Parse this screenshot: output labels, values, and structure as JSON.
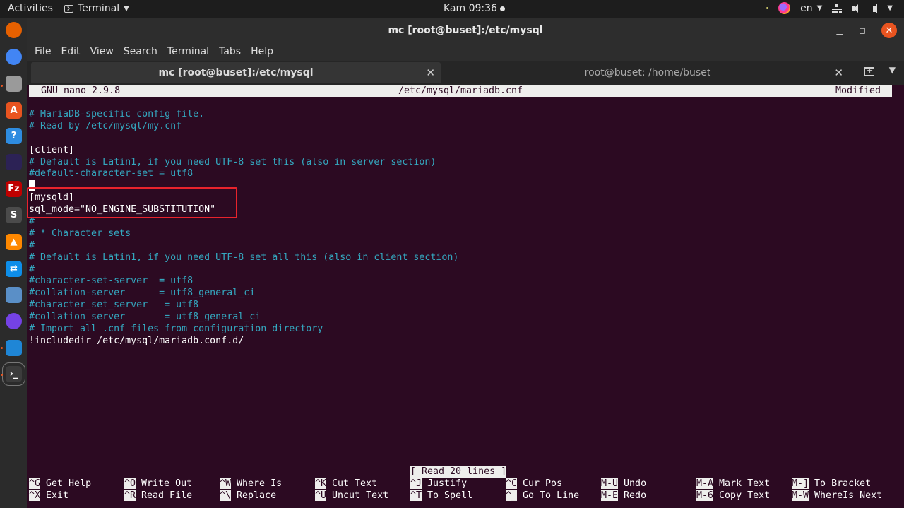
{
  "topbar": {
    "activities": "Activities",
    "app_name": "Terminal",
    "clock": "Kam 09:36",
    "lang": "en"
  },
  "window": {
    "title": "mc [root@buset]:/etc/mysql",
    "menu": [
      "File",
      "Edit",
      "View",
      "Search",
      "Terminal",
      "Tabs",
      "Help"
    ],
    "tabs": [
      {
        "label": "mc [root@buset]:/etc/mysql",
        "active": true
      },
      {
        "label": "root@buset: /home/buset",
        "active": false
      }
    ]
  },
  "nano": {
    "version": "GNU nano 2.9.8",
    "file": "/etc/mysql/mariadb.cnf",
    "status": "Modified",
    "lines": [
      {
        "text": "# MariaDB-specific config file.",
        "kind": "comment"
      },
      {
        "text": "# Read by /etc/mysql/my.cnf",
        "kind": "comment"
      },
      {
        "text": "",
        "kind": "plain"
      },
      {
        "text": "[client]",
        "kind": "plain"
      },
      {
        "text": "# Default is Latin1, if you need UTF-8 set this (also in server section)",
        "kind": "comment"
      },
      {
        "text": "#default-character-set = utf8",
        "kind": "comment"
      },
      {
        "text": "",
        "kind": "cursor"
      },
      {
        "text": "[mysqld]",
        "kind": "plain"
      },
      {
        "text": "sql_mode=\"NO_ENGINE_SUBSTITUTION\"",
        "kind": "plain"
      },
      {
        "text": "#",
        "kind": "comment"
      },
      {
        "text": "# * Character sets",
        "kind": "comment"
      },
      {
        "text": "#",
        "kind": "comment"
      },
      {
        "text": "# Default is Latin1, if you need UTF-8 set all this (also in client section)",
        "kind": "comment"
      },
      {
        "text": "#",
        "kind": "comment"
      },
      {
        "text": "#character-set-server  = utf8",
        "kind": "comment"
      },
      {
        "text": "#collation-server      = utf8_general_ci",
        "kind": "comment"
      },
      {
        "text": "#character_set_server   = utf8",
        "kind": "comment"
      },
      {
        "text": "#collation_server       = utf8_general_ci",
        "kind": "comment"
      },
      {
        "text": "# Import all .cnf files from configuration directory",
        "kind": "comment"
      },
      {
        "text": "!includedir /etc/mysql/mariadb.conf.d/",
        "kind": "plain"
      }
    ],
    "message": "[ Read 20 lines ]",
    "shortcuts_row1": [
      {
        "key": "^G",
        "label": "Get Help"
      },
      {
        "key": "^O",
        "label": "Write Out"
      },
      {
        "key": "^W",
        "label": "Where Is"
      },
      {
        "key": "^K",
        "label": "Cut Text"
      },
      {
        "key": "^J",
        "label": "Justify"
      },
      {
        "key": "^C",
        "label": "Cur Pos"
      },
      {
        "key": "M-U",
        "label": "Undo"
      },
      {
        "key": "M-A",
        "label": "Mark Text"
      },
      {
        "key": "M-]",
        "label": "To Bracket"
      }
    ],
    "shortcuts_row2": [
      {
        "key": "^X",
        "label": "Exit"
      },
      {
        "key": "^R",
        "label": "Read File"
      },
      {
        "key": "^\\",
        "label": "Replace"
      },
      {
        "key": "^U",
        "label": "Uncut Text"
      },
      {
        "key": "^T",
        "label": "To Spell"
      },
      {
        "key": "^_",
        "label": "Go To Line"
      },
      {
        "key": "M-E",
        "label": "Redo"
      },
      {
        "key": "M-6",
        "label": "Copy Text"
      },
      {
        "key": "M-W",
        "label": "WhereIs Next"
      }
    ]
  },
  "dock": [
    {
      "icon": "firefox-icon",
      "color": "#e66000"
    },
    {
      "icon": "chrome-icon",
      "color": "#4285f4"
    },
    {
      "icon": "files-icon",
      "color": "#9a9a9a"
    },
    {
      "icon": "software-center-icon",
      "color": "#e95420"
    },
    {
      "icon": "help-icon",
      "color": "#2e8ce0"
    },
    {
      "icon": "eclipse-icon",
      "color": "#2c2255"
    },
    {
      "icon": "filezilla-icon",
      "color": "#bf0000"
    },
    {
      "icon": "sublime-text-icon",
      "color": "#4b4b4b"
    },
    {
      "icon": "vlc-icon",
      "color": "#ff8800"
    },
    {
      "icon": "teamviewer-icon",
      "color": "#0e8ee9"
    },
    {
      "icon": "dbeaver-icon",
      "color": "#5a8fc7"
    },
    {
      "icon": "firefox-dev-icon",
      "color": "#7542e5"
    },
    {
      "icon": "vscode-icon",
      "color": "#1f86d6"
    },
    {
      "icon": "terminal-icon",
      "color": "#3c3c3c"
    }
  ]
}
